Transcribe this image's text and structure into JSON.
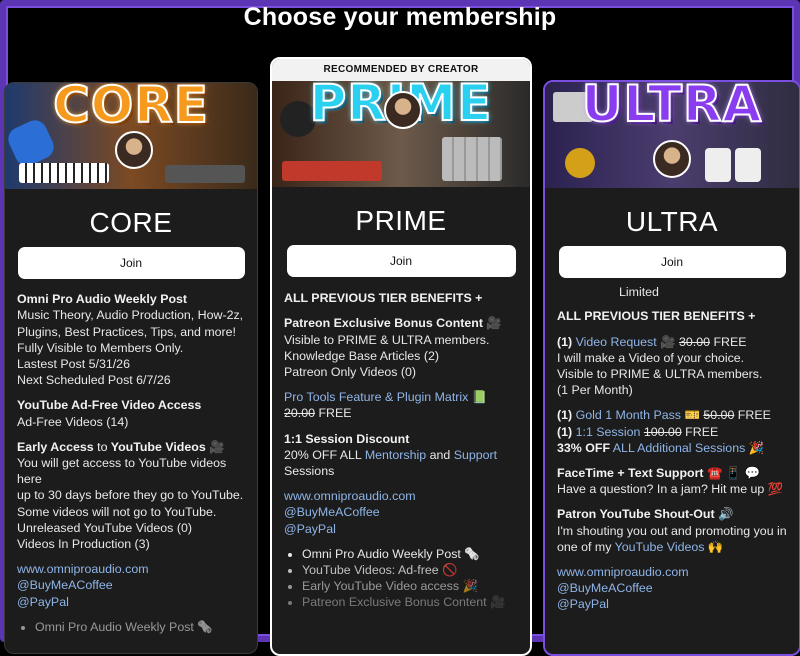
{
  "page_title": "Choose your membership",
  "recommended_label": "RECOMMENDED BY CREATOR",
  "colors": {
    "accent_purple": "#7a4fe0",
    "link_blue": "#8fb5e8",
    "card_bg": "#1c1c1c"
  },
  "core": {
    "banner_text": "CORE",
    "name": "CORE",
    "join_label": "Join",
    "s1_title": "Omni Pro Audio Weekly Post",
    "s1_lines": [
      "Music Theory, Audio Production, How-2z,",
      "Plugins, Best Practices, Tips, and more!",
      "Fully Visible to Members Only.",
      "Lastest Post 5/31/26",
      "Next Scheduled Post 6/7/26"
    ],
    "s2_title": "YouTube Ad-Free Video Access",
    "s2_line": "Ad-Free Videos (14)",
    "s3_title_a": "Early Access",
    "s3_title_b": "to",
    "s3_title_c": "YouTube Videos",
    "s3_icon": "🎥",
    "s3_lines": [
      "You will get access to YouTube videos here",
      "up to 30 days before they go to YouTube.",
      "Some videos will not go to YouTube.",
      "Unreleased YouTube Videos (0)",
      "Videos In Production (3)"
    ],
    "links": [
      "www.omniproaudio.com",
      "@BuyMeACoffee",
      "@PayPal"
    ],
    "bullet_partial": "Omni Pro Audio Weekly Post 🗞️"
  },
  "prime": {
    "banner_text": "PRIME",
    "name": "PRIME",
    "join_label": "Join",
    "prev": "ALL PREVIOUS TIER BENEFITS +",
    "s1_title": "Patreon Exclusive Bonus Content 🎥",
    "s1_lines": [
      "Visible to PRIME & ULTRA members.",
      "Knowledge Base Articles (2)",
      "Patreon Only Videos (0)"
    ],
    "s2_link": "Pro Tools Feature & Plugin Matrix",
    "s2_icon": "📗",
    "s2_price_old": "20.00",
    "s2_free": "FREE",
    "s3_title": "1:1 Session Discount",
    "s3_a": "20% OFF ALL",
    "s3_b": "Mentorship",
    "s3_c": "and",
    "s3_d": "Support",
    "s3_e": "Sessions",
    "links": [
      "www.omniproaudio.com",
      "@BuyMeACoffee",
      "@PayPal"
    ],
    "bullets": [
      "Omni Pro Audio Weekly Post 🗞️",
      "YouTube Videos: Ad-free 🚫",
      "Early YouTube Video access 🎉",
      "Patreon Exclusive Bonus Content 🎥"
    ]
  },
  "ultra": {
    "banner_text": "ULTRA",
    "name": "ULTRA",
    "join_label": "Join",
    "limited": "Limited",
    "prev": "ALL PREVIOUS TIER BENEFITS +",
    "s1_num": "(1)",
    "s1_link": "Video Request",
    "s1_icon": "🎥",
    "s1_price_old": "30.00",
    "s1_free": "FREE",
    "s1_lines": [
      "I will make a Video of your choice.",
      "Visible to PRIME & ULTRA members.",
      "(1 Per Month)"
    ],
    "s2a_num": "(1)",
    "s2a_link": "Gold 1 Month Pass",
    "s2a_icon": "🎫",
    "s2a_price_old": "50.00",
    "s2a_free": "FREE",
    "s2b_num": "(1)",
    "s2b_link": "1:1 Session",
    "s2b_price_old": "100.00",
    "s2b_free": "FREE",
    "s2c_a": "33% OFF",
    "s2c_link": "ALL Additional Sessions",
    "s2c_icon": "🎉",
    "s3_title": "FaceTime + Text Support ☎️ 📱 💬",
    "s3_line": "Have a question? In a jam? Hit me up 💯",
    "s4_title": "Patron YouTube Shout-Out 🔊",
    "s4_line1": "I'm shouting you out and promoting you in",
    "s4_line2a": "one of my",
    "s4_line2_link": "YouTube Videos",
    "s4_line2_icon": "🙌",
    "links": [
      "www.omniproaudio.com",
      "@BuyMeACoffee",
      "@PayPal"
    ]
  }
}
